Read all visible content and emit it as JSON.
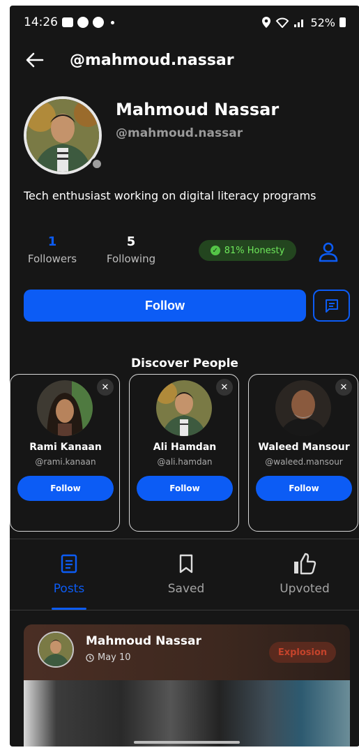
{
  "status_bar": {
    "time": "14:26",
    "battery": "52%"
  },
  "app_bar": {
    "title": "@mahmoud.nassar"
  },
  "profile": {
    "name": "Mahmoud Nassar",
    "handle": "@mahmoud.nassar",
    "bio": "Tech enthusiast working on digital literacy programs",
    "followers_count": "1",
    "followers_label": "Followers",
    "following_count": "5",
    "following_label": "Following",
    "honesty_label": "81% Honesty",
    "follow_label": "Follow",
    "colors": {
      "accent": "#0c5cf5",
      "honesty_bg": "#23451f",
      "honesty_text": "#6ee85b"
    }
  },
  "discover": {
    "title": "Discover People",
    "people": [
      {
        "name": "Rami Kanaan",
        "handle": "@rami.kanaan",
        "follow_label": "Follow"
      },
      {
        "name": "Ali Hamdan",
        "handle": "@ali.hamdan",
        "follow_label": "Follow"
      },
      {
        "name": "Waleed Mansour",
        "handle": "@waleed.mansour",
        "follow_label": "Follow"
      }
    ]
  },
  "tabs": [
    {
      "label": "Posts",
      "icon": "document-icon",
      "active": true
    },
    {
      "label": "Saved",
      "icon": "bookmark-icon",
      "active": false
    },
    {
      "label": "Upvoted",
      "icon": "thumbs-up-icon",
      "active": false
    }
  ],
  "post": {
    "author": "Mahmoud Nassar",
    "date": "May 10",
    "tag": "Explosion"
  }
}
